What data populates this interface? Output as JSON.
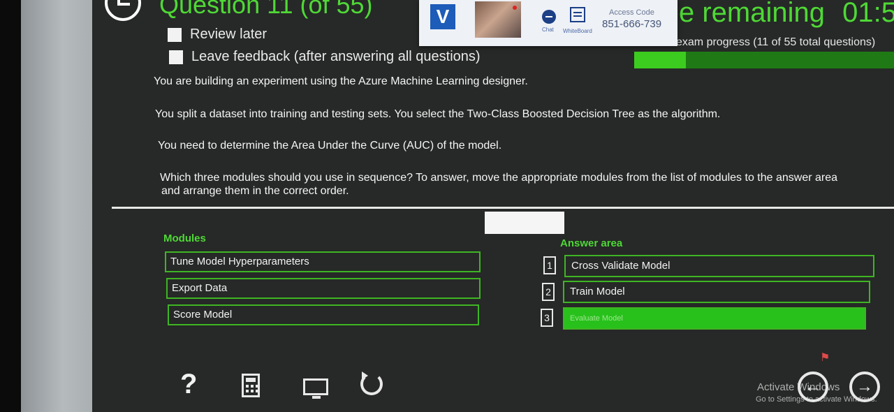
{
  "header": {
    "question_title": "Question 11 (of 55)",
    "review_later": "Review later",
    "leave_feedback": "Leave feedback (after answering all questions)",
    "time_remaining_label": "e remaining",
    "time_remaining_value": "01:5",
    "progress_label": "exam progress (11 of 55 total questions)",
    "progress_fraction": 0.2
  },
  "proctor": {
    "logo": "V",
    "chat_label": "Chat",
    "whiteboard_label": "WhiteBoard",
    "access_code_label": "Access Code",
    "access_code": "851-666-739"
  },
  "question": {
    "line1": "You are building an experiment using the Azure Machine Learning designer.",
    "line2": "You split a dataset into training and testing sets. You select the Two-Class Boosted Decision Tree as the algorithm.",
    "line3": "You need to determine the Area Under the Curve (AUC) of the model.",
    "line4a": "Which three modules should you use in sequence? To answer, move the appropriate modules from the list of modules to the answer area",
    "line4b": "and arrange them in the correct order."
  },
  "modules": {
    "title": "Modules",
    "items": [
      "Tune Model Hyperparameters",
      "Export Data",
      "Score Model"
    ]
  },
  "answer_area": {
    "title": "Answer area",
    "items": [
      {
        "num": "1",
        "label": "Cross Validate Model"
      },
      {
        "num": "2",
        "label": "Train Model"
      },
      {
        "num": "3",
        "label": "Evaluate Model"
      }
    ]
  },
  "toolbar": {
    "help_glyph": "?"
  },
  "watermark": {
    "line1": "Activate Windows",
    "line2": "Go to Settings to activate Windows."
  },
  "icons": [
    "back-icon",
    "chat-icon",
    "whiteboard-icon",
    "help-icon",
    "calculator-icon",
    "screen-icon",
    "reset-icon",
    "flag-icon",
    "previous-icon",
    "next-icon"
  ],
  "colors": {
    "accent_green": "#4fd836",
    "selected_green": "#28c11c",
    "background": "#262927"
  }
}
